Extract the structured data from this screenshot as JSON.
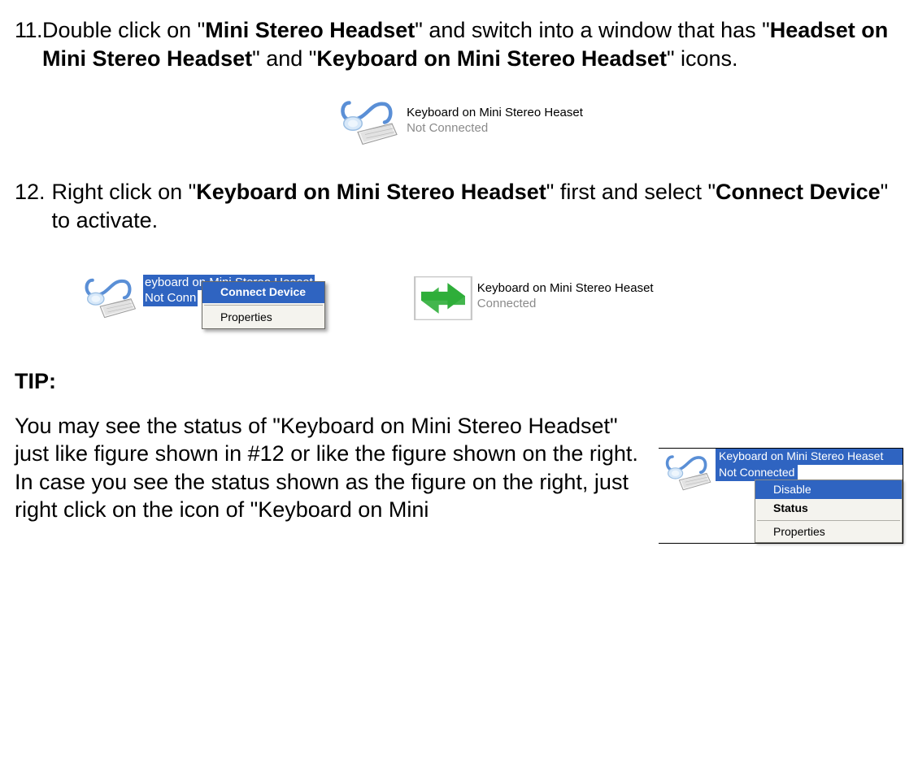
{
  "step11": {
    "num": "11.",
    "t1": "Double click on \"",
    "b1": "Mini Stereo Headset",
    "t2": "\" and switch into a window that has \"",
    "b2": "Headset on Mini Stereo Headset",
    "t3": "\" and \"",
    "b3": "Keyboard on Mini Stereo Headset",
    "t4": "\" icons."
  },
  "fig1": {
    "title": "Keyboard on Mini Stereo Heaset",
    "status": "Not Connected"
  },
  "step12": {
    "num": "12.",
    "t1": " Right click on \"",
    "b1": "Keyboard on Mini Stereo Headset",
    "t2": "\" first and select \"",
    "b2": "Connect Device",
    "t3": "\" to activate."
  },
  "fig2_left": {
    "title_vis": "eyboard on Mini Stereo Heaset",
    "status_vis": "Not Conn",
    "menu": {
      "connect": "Connect Device",
      "properties": "Properties"
    }
  },
  "fig2_right": {
    "title": "Keyboard on Mini Stereo Heaset",
    "status": "Connected"
  },
  "tip": {
    "heading": "TIP:",
    "p1a": "You may see the status of \"Keyboard on Mini Stereo Headset\" just like figure shown in #12 or like the figure shown on the right.",
    "p1b": "In case you see the status shown as the figure on the right, just right click on the icon of \"Keyboard on Mini",
    "fig": {
      "title": "Keyboard on Mini Stereo Heaset",
      "status": "Not Connected",
      "menu": {
        "disable": "Disable",
        "status": "Status",
        "properties": "Properties"
      }
    }
  }
}
